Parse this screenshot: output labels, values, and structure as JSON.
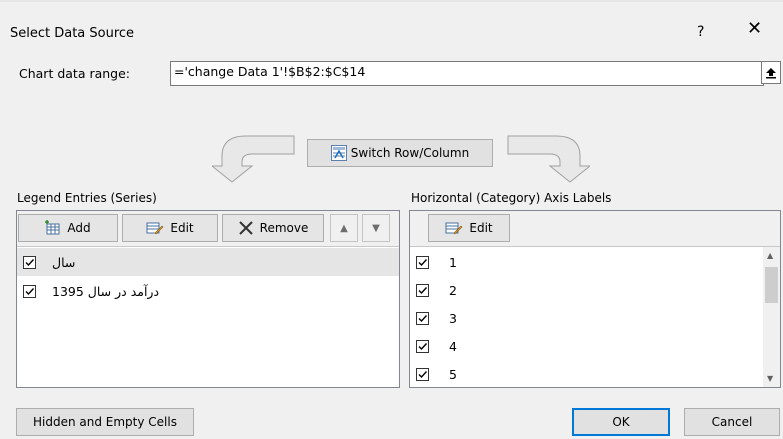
{
  "dialog": {
    "title": "Select Data Source",
    "help_label": "?",
    "close_label": "✕"
  },
  "range": {
    "label": "Chart data range:",
    "value": "='change Data 1'!$B$2:$C$14"
  },
  "switch_label": "Switch Row/Column",
  "legend": {
    "heading": "Legend Entries (Series)",
    "add_label": "Add",
    "edit_label": "Edit",
    "remove_label": "Remove",
    "up_label": "▲",
    "down_label": "▼",
    "items": [
      {
        "label": "سال",
        "checked": true,
        "selected": true
      },
      {
        "label": "درآمد در سال 1395",
        "checked": true,
        "selected": false
      }
    ]
  },
  "axis": {
    "heading": "Horizontal (Category) Axis Labels",
    "edit_label": "Edit",
    "items": [
      {
        "label": "1",
        "checked": true
      },
      {
        "label": "2",
        "checked": true
      },
      {
        "label": "3",
        "checked": true
      },
      {
        "label": "4",
        "checked": true
      },
      {
        "label": "5",
        "checked": true
      }
    ]
  },
  "footer": {
    "hidden_cells_label": "Hidden and Empty Cells",
    "ok_label": "OK",
    "cancel_label": "Cancel"
  },
  "colors": {
    "accent": "#0078d7",
    "selected_row": "#e5e5e5",
    "arrow_fill": "#e8e8e8",
    "arrow_stroke": "#a0a0a0"
  }
}
